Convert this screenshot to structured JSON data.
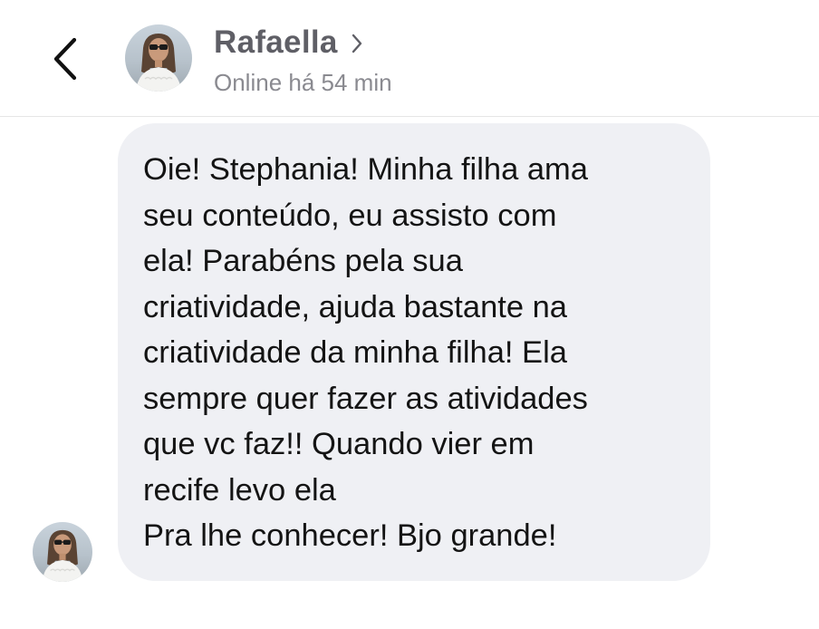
{
  "header": {
    "back_icon": "chevron-left-icon",
    "contact": {
      "name": "Rafaella",
      "name_chevron_icon": "chevron-right-icon",
      "status": "Online há 54 min",
      "avatar_icon": "profile-photo-avatar"
    }
  },
  "message": {
    "sender_avatar_icon": "profile-photo-avatar",
    "bubble_color": "#eff0f4",
    "lines": [
      "Oie! Stephania! Minha filha ama",
      "seu conteúdo, eu assisto com",
      "ela! Parabéns pela sua",
      "criatividade, ajuda bastante na",
      "criatividade da minha filha! Ela",
      "sempre quer fazer as atividades",
      "que vc faz!! Quando vier em",
      "recife levo ela",
      "Pra lhe conhecer! Bjo grande!"
    ]
  }
}
